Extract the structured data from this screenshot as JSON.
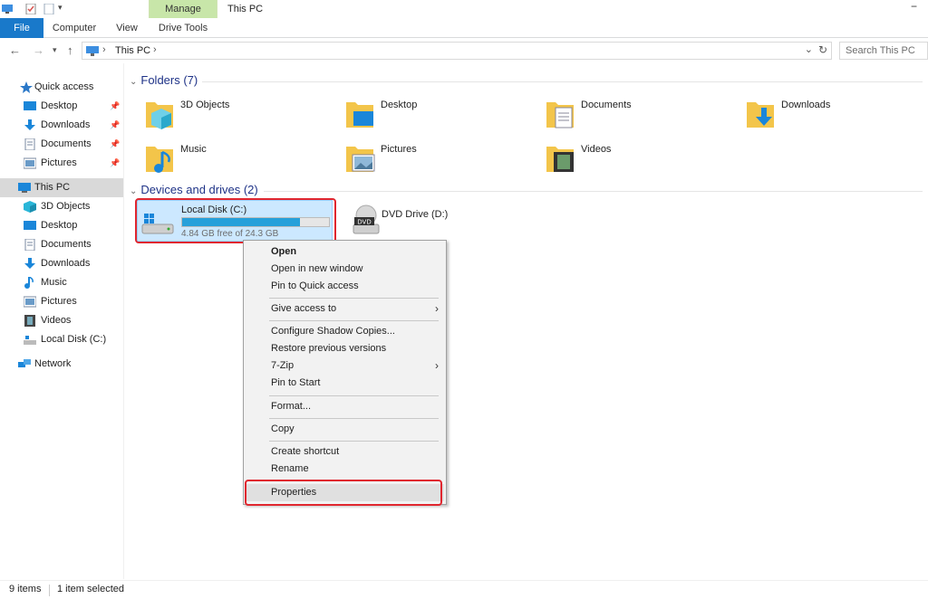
{
  "ribbon": {
    "file_tab": "File",
    "computer_tab": "Computer",
    "view_tab": "View",
    "manage_label": "Manage",
    "drive_tools_tab": "Drive Tools",
    "window_title": "This PC",
    "minimize_glyph": "−"
  },
  "address": {
    "path": "This PC",
    "search_placeholder": "Search This PC"
  },
  "sidebar": {
    "items": [
      {
        "label": "Quick access",
        "icon": "star-icon"
      },
      {
        "label": "Desktop",
        "icon": "desktop-icon",
        "pinned": true
      },
      {
        "label": "Downloads",
        "icon": "downloads-icon",
        "pinned": true
      },
      {
        "label": "Documents",
        "icon": "documents-icon",
        "pinned": true
      },
      {
        "label": "Pictures",
        "icon": "pictures-icon",
        "pinned": true
      },
      {
        "label": "This PC",
        "icon": "computer-icon",
        "selected": true
      },
      {
        "label": "3D Objects",
        "icon": "3d-objects-icon"
      },
      {
        "label": "Desktop",
        "icon": "desktop-icon"
      },
      {
        "label": "Documents",
        "icon": "documents-icon"
      },
      {
        "label": "Downloads",
        "icon": "downloads-icon"
      },
      {
        "label": "Music",
        "icon": "music-icon"
      },
      {
        "label": "Pictures",
        "icon": "pictures-icon"
      },
      {
        "label": "Videos",
        "icon": "videos-icon"
      },
      {
        "label": "Local Disk (C:)",
        "icon": "drive-icon"
      },
      {
        "label": "Network",
        "icon": "network-icon"
      }
    ]
  },
  "folders_group": {
    "header": "Folders (7)",
    "items": [
      {
        "label": "3D Objects",
        "icon": "3d-objects-folder-icon"
      },
      {
        "label": "Desktop",
        "icon": "desktop-folder-icon"
      },
      {
        "label": "Documents",
        "icon": "documents-folder-icon"
      },
      {
        "label": "Downloads",
        "icon": "downloads-folder-icon"
      },
      {
        "label": "Music",
        "icon": "music-folder-icon"
      },
      {
        "label": "Pictures",
        "icon": "pictures-folder-icon"
      },
      {
        "label": "Videos",
        "icon": "videos-folder-icon"
      }
    ]
  },
  "drives_group": {
    "header": "Devices and drives (2)",
    "drive_c": {
      "name": "Local Disk (C:)",
      "free_text": "4.84 GB free of 24.3 GB",
      "used_fraction": 0.8
    },
    "drive_d": {
      "name": "DVD Drive (D:)",
      "badge": "DVD"
    }
  },
  "context_menu": {
    "items": [
      {
        "label": "Open",
        "bold": true
      },
      {
        "label": "Open in new window"
      },
      {
        "label": "Pin to Quick access"
      },
      {
        "label": "Give access to",
        "submenu": true
      },
      {
        "label": "Configure Shadow Copies..."
      },
      {
        "label": "Restore previous versions"
      },
      {
        "label": "7-Zip",
        "submenu": true
      },
      {
        "label": "Pin to Start"
      },
      {
        "label": "Format..."
      },
      {
        "label": "Copy"
      },
      {
        "label": "Create shortcut"
      },
      {
        "label": "Rename"
      },
      {
        "label": "Properties",
        "highlighted": true
      }
    ],
    "submenu_glyph": "›"
  },
  "status": {
    "count": "9 items",
    "selected": "1 item selected"
  },
  "colors": {
    "accent": "#1979ca",
    "folder_yellow": "#f3c54a",
    "selection_bg": "#cce8ff",
    "progress": "#26a0da",
    "highlight_outline": "#e0262f",
    "group_header": "#1e3287"
  }
}
